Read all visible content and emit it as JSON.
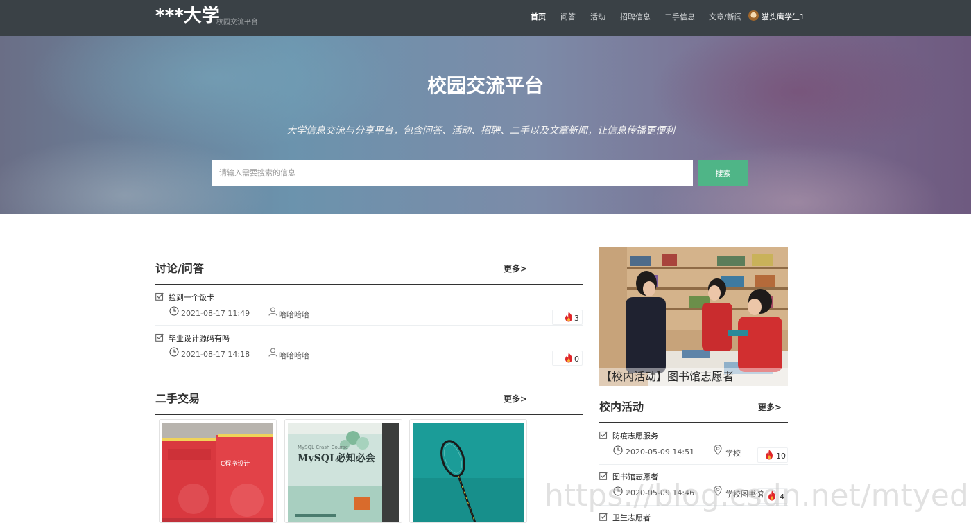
{
  "navbar": {
    "brand": "***大学",
    "brand_sub": "校园交流平台",
    "items": [
      {
        "label": "首页",
        "active": true
      },
      {
        "label": "问答"
      },
      {
        "label": "活动"
      },
      {
        "label": "招聘信息"
      },
      {
        "label": "二手信息"
      },
      {
        "label": "文章/新闻"
      }
    ],
    "user": {
      "name": "猫头鹰学生1",
      "avatar_icon": "owl-avatar"
    }
  },
  "hero": {
    "title": "校园交流平台",
    "description": "大学信息交流与分享平台，包含问答、活动、招聘、二手以及文章新闻，让信息传播更便利",
    "search_placeholder": "请输入需要搜索的信息",
    "search_button": "搜索"
  },
  "qa": {
    "title": "讨论/问答",
    "more": "更多>",
    "items": [
      {
        "title": "捡到一个饭卡",
        "time": "2021-08-17 11:49",
        "author": "哈哈哈哈",
        "hot": "3"
      },
      {
        "title": "毕业设计源码有吗",
        "time": "2021-08-17 14:18",
        "author": "哈哈哈哈",
        "hot": "0"
      }
    ]
  },
  "secondhand": {
    "title": "二手交易",
    "more": "更多>",
    "cards": [
      {
        "image": "red-c-programming-books",
        "book_title": "C程序设计"
      },
      {
        "image": "mysql-crash-course-book",
        "book_title": "MySQL必知必会",
        "book_subtitle": "MySQL Crash Course"
      },
      {
        "image": "badminton-racket-on-teal"
      }
    ]
  },
  "activity": {
    "banner_caption": "【校内活动】图书馆志愿者",
    "banner_image": "library-volunteers-photo",
    "title": "校内活动",
    "more": "更多>",
    "items": [
      {
        "title": "防疫志愿服务",
        "time": "2020-05-09 14:51",
        "place": "学校",
        "hot": "10"
      },
      {
        "title": "图书馆志愿者",
        "time": "2020-05-09 14:46",
        "place": "学校图书馆",
        "hot": "4"
      },
      {
        "title": "卫生志愿者"
      }
    ]
  },
  "watermark": "https://blog.csdn.net/mtyedu",
  "colors": {
    "navbar": "#3a4146",
    "search_button": "#4fb587",
    "hot_flame": "#e0262a"
  }
}
